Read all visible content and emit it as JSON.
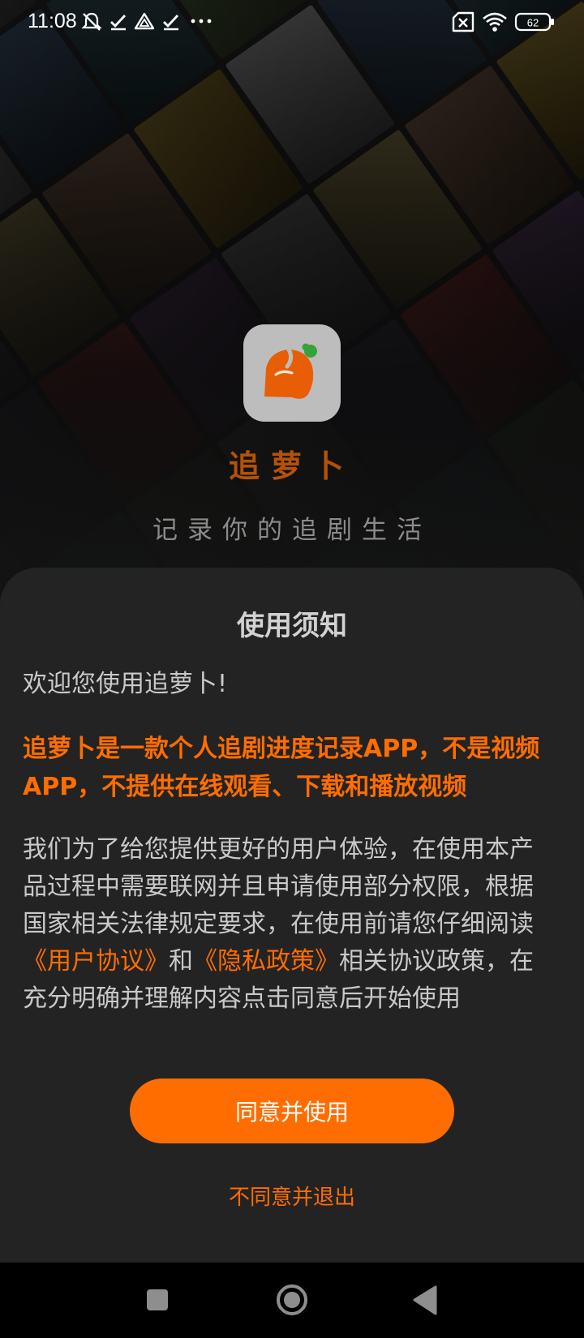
{
  "status_bar": {
    "time": "11:08",
    "left_icons": [
      "notifications-muted-icon",
      "check-icon",
      "warning-triangle-icon",
      "check-icon",
      "more-dots-icon"
    ],
    "right_icons": [
      "no-sim-icon",
      "wifi-icon",
      "battery-icon"
    ],
    "battery_level": "62"
  },
  "brand": {
    "app_name": "追萝卜",
    "slogan": "记录你的追剧生活",
    "logo_icon": "carrot-logo-icon"
  },
  "dialog": {
    "title": "使用须知",
    "welcome": "欢迎您使用追萝卜!",
    "warning": "追萝卜是一款个人追剧进度记录APP，不是视频APP，不提供在线观看、下载和播放视频",
    "body_part1": "我们为了给您提供更好的用户体验，在使用本产品过程中需要联网并且申请使用部分权限，根据国家相关法律规定要求，在使用前请您仔细阅读",
    "user_agreement_link": "《用户协议》",
    "body_and": "和",
    "privacy_policy_link": "《隐私政策》",
    "body_part2": "相关协议政策，在充分明确并理解内容点击同意后开始使用",
    "agree_button": "同意并使用",
    "disagree_button": "不同意并退出"
  },
  "nav_bar": {
    "recents_icon": "square-recents-icon",
    "home_icon": "circle-home-icon",
    "back_icon": "triangle-back-icon"
  },
  "colors": {
    "accent": "#ff6d00",
    "brand_name": "#b35207",
    "dialog_bg": "#232323",
    "text": "#c9c9c9"
  }
}
